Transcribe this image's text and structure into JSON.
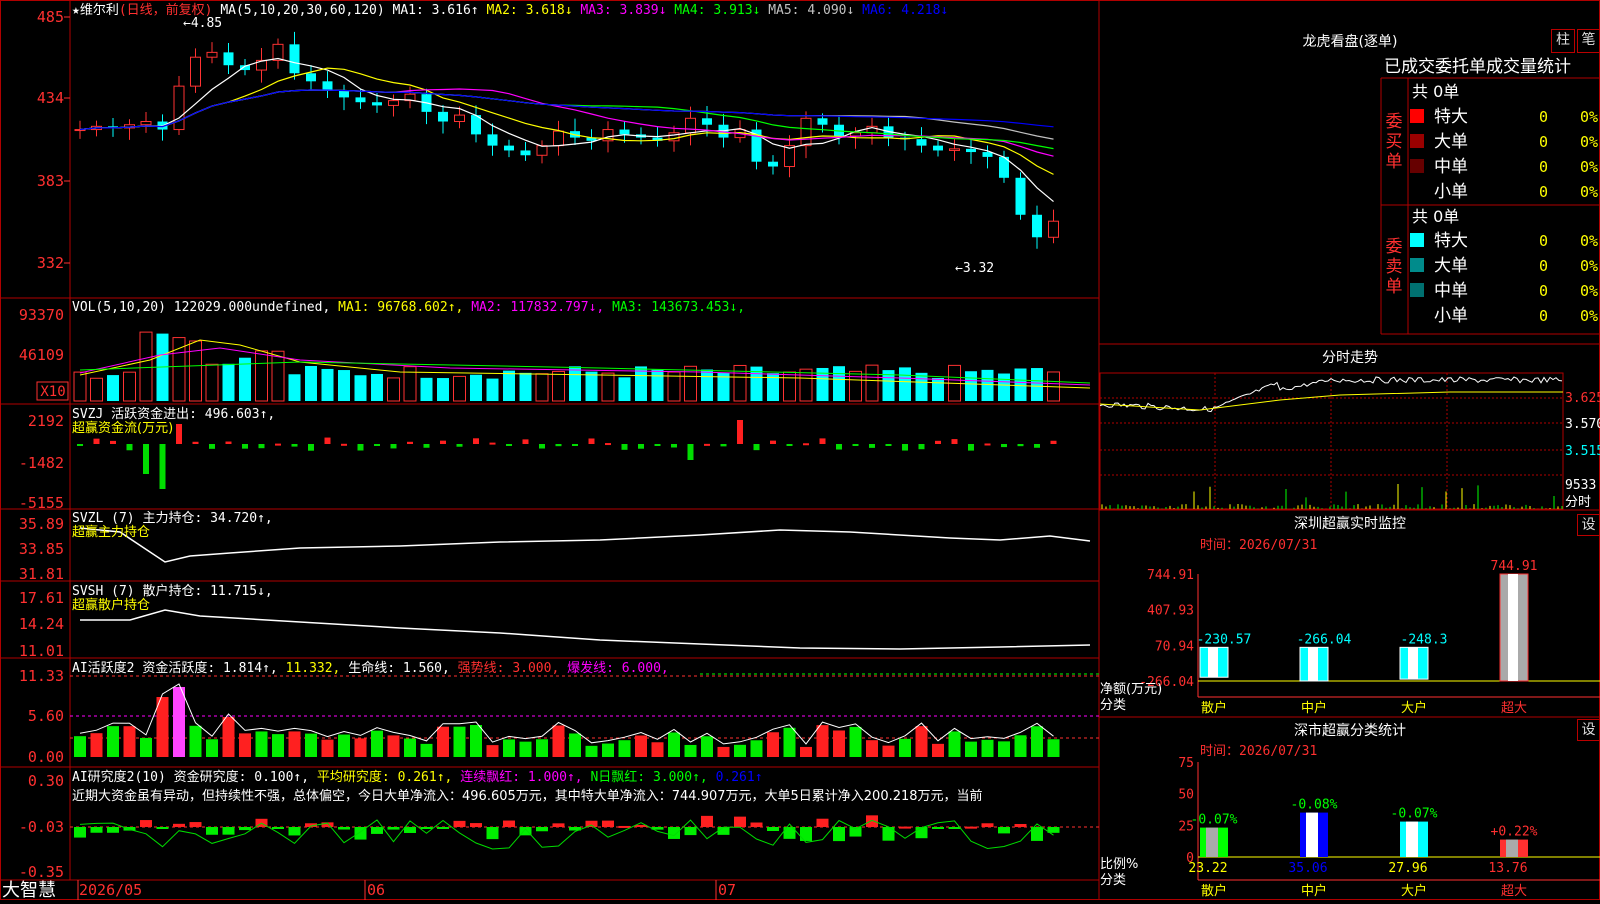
{
  "stock": {
    "marker": "★",
    "name": "维尔利",
    "period_tag": "(日线，前复权)"
  },
  "main_panel": {
    "ma_header_label": "MA(5,10,20,30,60,120)",
    "ma_values": [
      {
        "label": "MA1:",
        "value": "3.616",
        "arrow": "↑",
        "color": "#ffffff"
      },
      {
        "label": "MA2:",
        "value": "3.618",
        "arrow": "↓",
        "color": "#ffff00"
      },
      {
        "label": "MA3:",
        "value": "3.839",
        "arrow": "↓",
        "color": "#ff00ff"
      },
      {
        "label": "MA4:",
        "value": "3.913",
        "arrow": "↓",
        "color": "#00ff00"
      },
      {
        "label": "MA5:",
        "value": "4.090",
        "arrow": "↓",
        "color": "#c0c0c0"
      },
      {
        "label": "MA6:",
        "value": "4.218",
        "arrow": "↓",
        "color": "#0000ff"
      }
    ],
    "y_ticks": [
      "485",
      "434",
      "383",
      "332"
    ],
    "high_label": "4.85",
    "low_label": "3.32"
  },
  "vol_panel": {
    "header_label": "VOL(5,10,20)",
    "value": "122029.000",
    "value_arrow": "↑",
    "ma_values": [
      {
        "label": "MA1:",
        "value": "96768.602",
        "arrow": "↑",
        "color": "#ffff00"
      },
      {
        "label": "MA2:",
        "value": "117832.797",
        "arrow": "↓",
        "color": "#ff00ff"
      },
      {
        "label": "MA3:",
        "value": "143673.453",
        "arrow": "↓",
        "color": "#00ff00"
      }
    ],
    "y_ticks": [
      "93370",
      "46109"
    ],
    "unit": "X10"
  },
  "svzj_panel": {
    "header_label": "SVZJ",
    "label": "活跃资金进出:",
    "value": "496.603",
    "arrow": "↑,",
    "subtitle": "超赢资金流(万元)",
    "y_ticks": [
      "2192",
      "-1482",
      "-5155"
    ]
  },
  "svzl_panel": {
    "header_label": "SVZL (7)",
    "label": "主力持仓:",
    "value": "34.720",
    "arrow": "↑,",
    "subtitle": "超赢主力持仓",
    "y_ticks": [
      "35.89",
      "33.85",
      "31.81"
    ]
  },
  "svsh_panel": {
    "header_label": "SVSH (7)",
    "label": "散户持仓:",
    "value": "11.715",
    "arrow": "↓,",
    "subtitle": "超赢散户持仓",
    "y_ticks": [
      "17.61",
      "14.24",
      "11.01"
    ]
  },
  "ai_active_panel": {
    "header_label": "AI活跃度2",
    "label": "资金活跃度:",
    "value": "1.814",
    "arrow": "↑,",
    "value2": "11.332,",
    "life_label": "生命线:",
    "life_value": "1.560,",
    "strong_label": "强势线:",
    "strong_value": "3.000,",
    "burst_label": "爆发线:",
    "burst_value": "6.000,",
    "y_ticks": [
      "11.33",
      "5.60",
      "0.00"
    ]
  },
  "ai_research_panel": {
    "header_label": "AI研究度2(10)",
    "label": "资金研究度:",
    "value": "0.100",
    "arrow": "↑,",
    "avg_label": "平均研究度:",
    "avg_value": "0.261",
    "avg_arrow": "↑,",
    "red_label": "连续飘红:",
    "red_value": "1.000",
    "red_arrow": "↑,",
    "nday_label": "N日飘红:",
    "nday_value": "3.000",
    "nday_arrow": "↑,",
    "last_value": "0.261",
    "last_arrow": "↑",
    "commentary": "近期大资金虽有异动，但持续性不强，总体偏空，今日大单净流入：496.605万元，其中特大单净流入：744.907万元，大单5日累计净入200.218万元，当前",
    "y_ticks": [
      "0.30",
      "-0.03",
      "-0.35"
    ]
  },
  "date_axis": {
    "labels": [
      "2026/05",
      "06",
      "07"
    ]
  },
  "brand": "大智慧",
  "dragon_panel": {
    "title": "龙虎看盘(逐单)",
    "btn_zhu": "柱",
    "btn_bi": "笔",
    "subtitle": "已成交委托单成交量统计",
    "buy_label": "委买单",
    "sell_label": "委卖单",
    "buy_total": "共 0单",
    "sell_total": "共 0单",
    "buy_rows": [
      {
        "name": "特大",
        "count": "0",
        "pct": "0%",
        "color": "#ff0000"
      },
      {
        "name": "大单",
        "count": "0",
        "pct": "0%",
        "color": "#990000"
      },
      {
        "name": "中单",
        "count": "0",
        "pct": "0%",
        "color": "#660000"
      },
      {
        "name": "小单",
        "count": "0",
        "pct": "0%",
        "color": "#000000"
      }
    ],
    "sell_rows": [
      {
        "name": "特大",
        "count": "0",
        "pct": "0%",
        "color": "#00ffff"
      },
      {
        "name": "大单",
        "count": "0",
        "pct": "0%",
        "color": "#008b8b"
      },
      {
        "name": "中单",
        "count": "0",
        "pct": "0%",
        "color": "#007070"
      },
      {
        "name": "小单",
        "count": "0",
        "pct": "0%",
        "color": "#000000"
      }
    ]
  },
  "intraday_panel": {
    "title": "分时走势",
    "y_ticks": [
      "3.625",
      "3.570",
      "3.515"
    ],
    "vol_tick": "9533",
    "vol_label": "分时"
  },
  "monitor_panel": {
    "title": "深圳超赢实时监控",
    "btn": "设",
    "time_label": "时间：",
    "time_value": "2026/07/31",
    "y_ticks": [
      "744.91",
      "407.93",
      "70.94",
      "-266.04"
    ],
    "net_label": "净额(万元)",
    "cat_label": "分类",
    "chart_data": {
      "type": "bar",
      "categories": [
        "散户",
        "中户",
        "大户",
        "超大"
      ],
      "values": [
        -230.57,
        -266.04,
        -248.3,
        744.91
      ],
      "value_labels": [
        "-230.57",
        "-266.04",
        "-248.3",
        "744.91"
      ],
      "ylim": [
        -266.04,
        744.91
      ]
    }
  },
  "classify_panel": {
    "title": "深市超赢分类统计",
    "btn": "设",
    "time_label": "时间：",
    "time_value": "2026/07/31",
    "y_ticks": [
      "75",
      "50",
      "25",
      "0"
    ],
    "ratio_label": "比例%",
    "cat_label": "分类",
    "chart_data": {
      "type": "bar",
      "categories": [
        "散户",
        "中户",
        "大户",
        "超大"
      ],
      "values": [
        23.22,
        35.06,
        27.96,
        13.76
      ],
      "value_labels": [
        "23.22",
        "35.06",
        "27.96",
        "13.76"
      ],
      "change_labels": [
        "-0.07%",
        "-0.08%",
        "-0.07%",
        "+0.22%"
      ],
      "ylim": [
        0,
        75
      ]
    }
  }
}
